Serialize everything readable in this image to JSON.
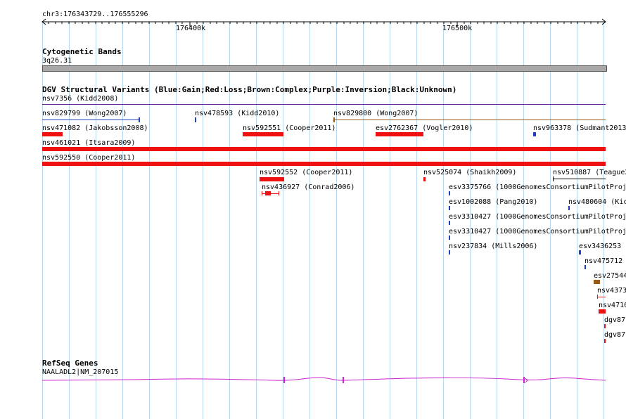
{
  "ruler": {
    "region": "chr3:176343729..176555296",
    "ticks": [
      "176400k",
      "176500k"
    ]
  },
  "cyto": {
    "title": "Cytogenetic Bands",
    "band": "3q26.31"
  },
  "dgv": {
    "title": "DGV Structural Variants (Blue:Gain;Red:Loss;Brown:Complex;Purple:Inversion;Black:Unknown)",
    "features": [
      {
        "label": "nsv7356 (Kidd2008)",
        "type": "Inversion",
        "color": "#6020a0"
      },
      {
        "label": "nsv829799 (Wong2007)",
        "type": "Gain",
        "color": "#1f3fbf"
      },
      {
        "label": "nsv478593 (Kidd2010)",
        "type": "Gain",
        "color": "#1f3fbf"
      },
      {
        "label": "nsv829800 (Wong2007)",
        "type": "Complex",
        "color": "#9a5a1a"
      },
      {
        "label": "nsv471082 (Jakobsson2008)",
        "type": "Loss",
        "color": "#ee1111"
      },
      {
        "label": "nsv592551 (Cooper2011)",
        "type": "Loss",
        "color": "#ee1111"
      },
      {
        "label": "esv2762367 (Vogler2010)",
        "type": "Loss",
        "color": "#ee1111"
      },
      {
        "label": "nsv963378 (Sudmant2013",
        "type": "Gain",
        "color": "#1f3fbf"
      },
      {
        "label": "nsv461021 (Itsara2009)",
        "type": "Loss",
        "color": "#ee1111"
      },
      {
        "label": "nsv592550 (Cooper2011)",
        "type": "Loss",
        "color": "#ee1111"
      },
      {
        "label": "nsv592552 (Cooper2011)",
        "type": "Loss",
        "color": "#ee1111"
      },
      {
        "label": "nsv525074 (Shaikh2009)",
        "type": "Loss",
        "color": "#ee1111"
      },
      {
        "label": "nsv510887 (Teague2",
        "type": "Unknown",
        "color": "#000000"
      },
      {
        "label": "nsv436927 (Conrad2006)",
        "type": "Loss",
        "color": "#ee1111"
      },
      {
        "label": "esv3375766 (1000GenomesConsortiumPilotProj",
        "type": "Gain",
        "color": "#1f3fbf"
      },
      {
        "label": "esv1002088 (Pang2010)",
        "type": "Gain",
        "color": "#1f3fbf"
      },
      {
        "label": "nsv480604 (Kic",
        "type": "Gain",
        "color": "#1f3fbf"
      },
      {
        "label": "esv3310427 (1000GenomesConsortiumPilotProj",
        "type": "Gain",
        "color": "#1f3fbf"
      },
      {
        "label": "esv3310427 (1000GenomesConsortiumPilotProj",
        "type": "Gain",
        "color": "#1f3fbf"
      },
      {
        "label": "nsv237834 (Mills2006)",
        "type": "Gain",
        "color": "#1f3fbf"
      },
      {
        "label": "esv3436253",
        "type": "Gain",
        "color": "#1f3fbf"
      },
      {
        "label": "nsv475712",
        "type": "Gain",
        "color": "#1f3fbf"
      },
      {
        "label": "esv27544",
        "type": "Complex",
        "color": "#9a5a1a"
      },
      {
        "label": "nsv4373",
        "type": "Loss",
        "color": "#ee1111"
      },
      {
        "label": "nsv4710",
        "type": "Loss",
        "color": "#ee1111"
      },
      {
        "label": "dgv87",
        "type": "Loss",
        "color": "#ee1111"
      },
      {
        "label": "dgv87",
        "type": "Loss",
        "color": "#ee1111"
      }
    ]
  },
  "refseq": {
    "title": "RefSeq Genes",
    "gene": "NAALADL2|NM_207015",
    "color": "#cc22cc"
  }
}
